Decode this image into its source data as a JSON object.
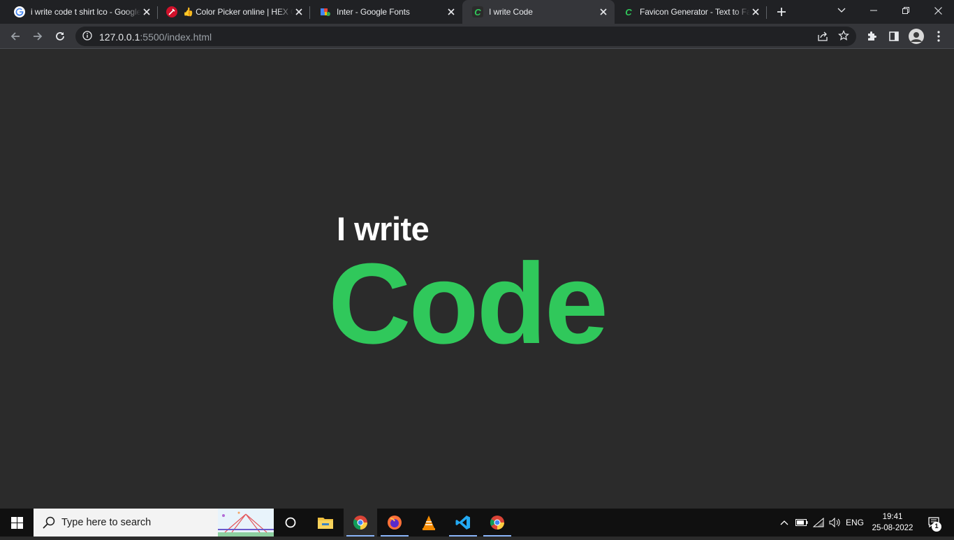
{
  "browser": {
    "tabs": [
      {
        "title": "i write code t shirt lco - Google",
        "favicon": "google-g-icon",
        "active": false
      },
      {
        "title": "👍 Color Picker online | HEX C",
        "favicon": "color-picker-icon",
        "active": false
      },
      {
        "title": "Inter - Google Fonts",
        "favicon": "google-fonts-icon",
        "active": false
      },
      {
        "title": "I write Code",
        "favicon": "c-letter-icon",
        "active": true
      },
      {
        "title": "Favicon Generator - Text to Fa",
        "favicon": "c-letter-icon",
        "active": false
      }
    ],
    "address": {
      "host": "127.0.0.1",
      "rest": ":5500/index.html"
    }
  },
  "page": {
    "line1": "I write",
    "line2": "Code",
    "colors": {
      "background": "#2b2b2b",
      "line1": "#ffffff",
      "accent": "#30c85b"
    }
  },
  "taskbar": {
    "search_placeholder": "Type here to search",
    "language": "ENG",
    "time": "19:41",
    "date": "25-08-2022",
    "notification_count": "1",
    "pinned_apps": [
      "file-explorer-icon",
      "chrome-icon",
      "firefox-icon",
      "vlc-icon",
      "vscode-icon",
      "chrome-icon"
    ]
  }
}
